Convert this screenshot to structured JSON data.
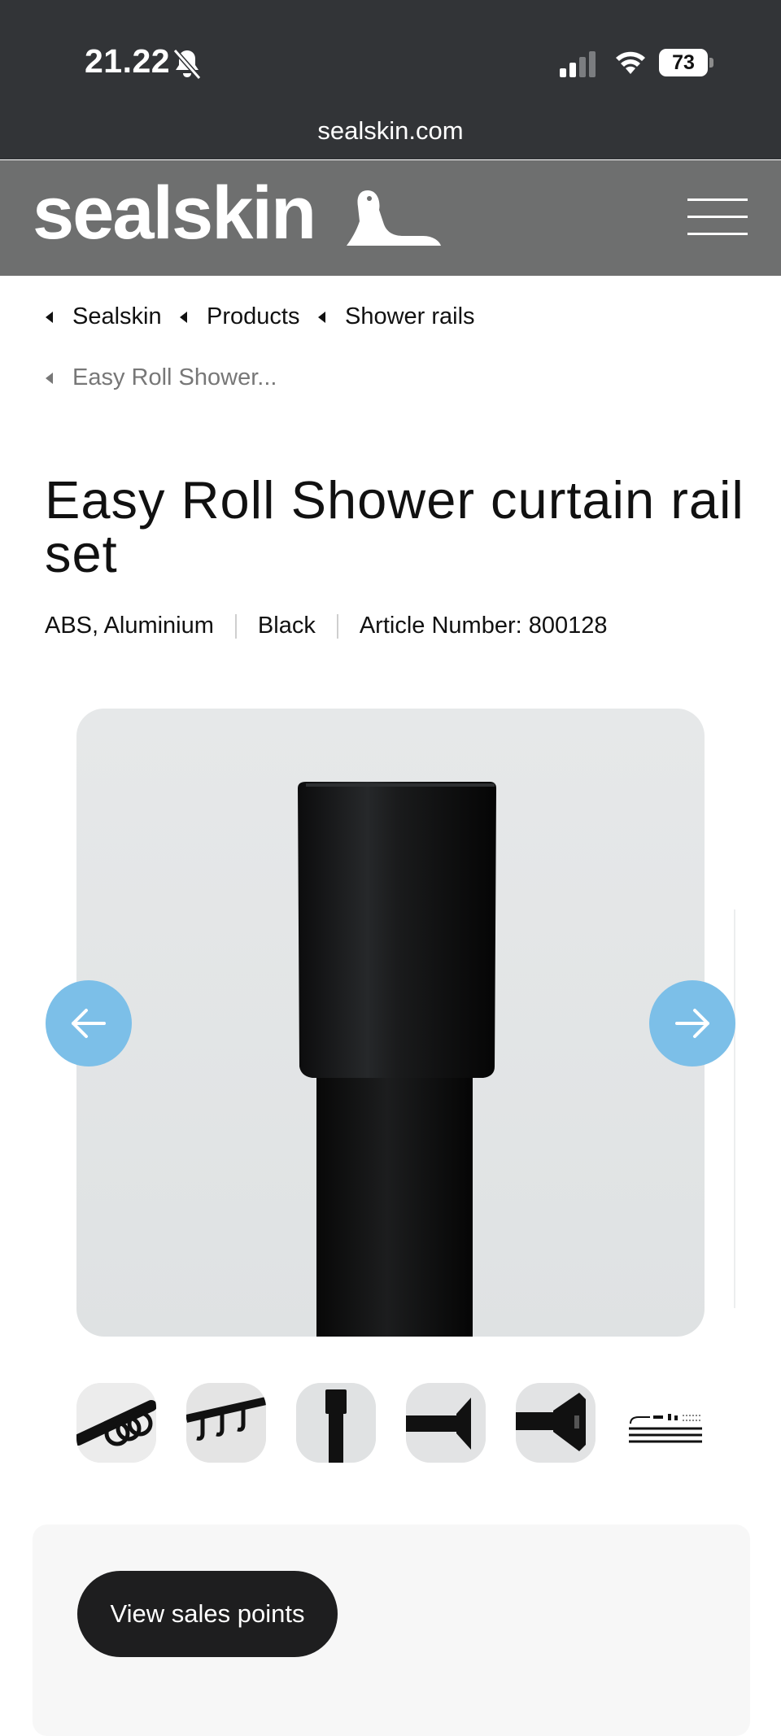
{
  "status_bar": {
    "time": "21.22",
    "battery": "73"
  },
  "browser": {
    "url": "sealskin.com"
  },
  "header": {
    "logo_text": "sealskin"
  },
  "breadcrumb": [
    {
      "label": "Sealskin"
    },
    {
      "label": "Products"
    },
    {
      "label": "Shower rails"
    },
    {
      "label": "Easy Roll Shower..."
    }
  ],
  "product": {
    "title": "Easy Roll Shower curtain rail set",
    "material": "ABS, Aluminium",
    "color": "Black",
    "article": "Article Number: 800128"
  },
  "gallery": {
    "thumbnail_count": 6,
    "accent_color": "#7cbfe8"
  },
  "cta": {
    "sales_points_label": "View sales points"
  }
}
